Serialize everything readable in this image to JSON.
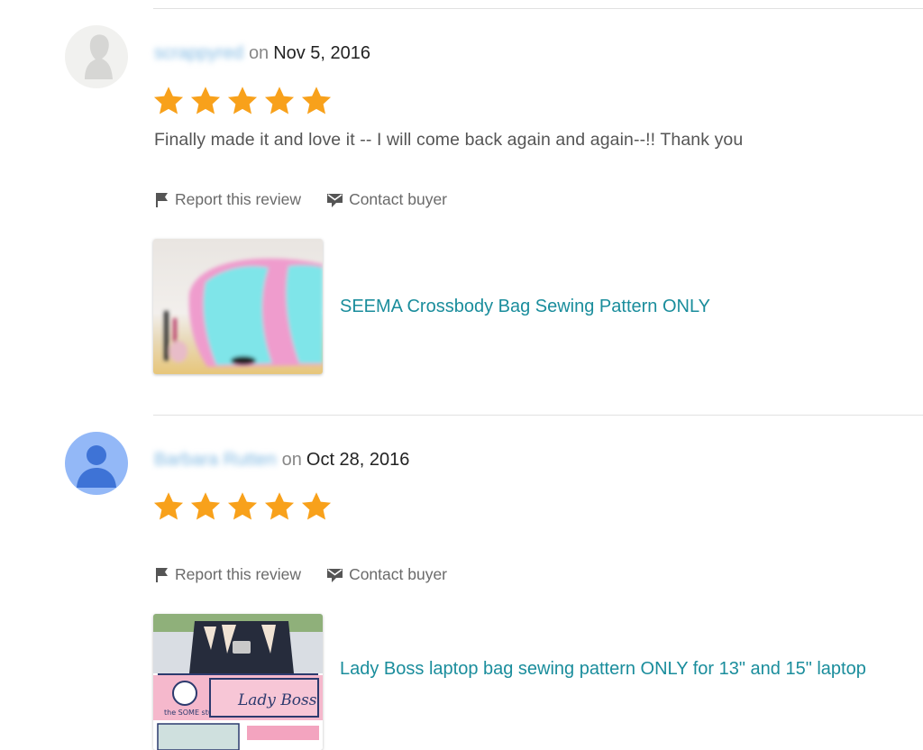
{
  "reviews": [
    {
      "reviewer": "scrappyred",
      "on": "on",
      "date": "Nov 5, 2016",
      "rating": 5,
      "text": "Finally made it and love it -- I will come back again and again--!! Thank you",
      "report_label": "Report this review",
      "contact_label": "Contact buyer",
      "product_title": "SEEMA Crossbody Bag Sewing Pattern ONLY",
      "avatar": "default-grey-avatar"
    },
    {
      "reviewer": "Barbara Rutten",
      "on": "on",
      "date": "Oct 28, 2016",
      "rating": 5,
      "text": "",
      "report_label": "Report this review",
      "contact_label": "Contact buyer",
      "product_title": "Lady Boss laptop bag sewing pattern ONLY for 13\" and 15\" laptop",
      "avatar": "default-blue-person-avatar"
    }
  ],
  "product_images": {
    "lady_boss_banner": "Lady Boss",
    "brand_logo": "the SOME stuff"
  },
  "colors": {
    "star": "#f8a11b",
    "link": "#1a8d9c",
    "divider": "#e1e1e1",
    "date": "#222222"
  },
  "icons": [
    "flag-icon",
    "message-icon",
    "star-icon"
  ]
}
